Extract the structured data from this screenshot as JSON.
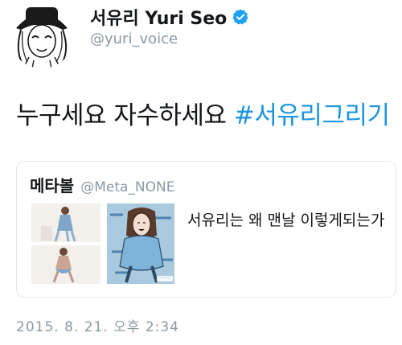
{
  "author": {
    "display_name": "서유리 Yuri Seo",
    "handle": "@yuri_voice",
    "verified": true,
    "avatar_icon": "caricature-avatar-icon"
  },
  "tweet": {
    "text": "누구세요 자수하세요 ",
    "hashtag": "#서유리그리기",
    "timestamp": "2015. 8. 21. 오후 2:34"
  },
  "quoted_tweet": {
    "display_name": "메타볼",
    "handle": "@Meta_NONE",
    "text": "서유리는 왜 맨날 이렇게되는가"
  },
  "colors": {
    "link": "#1b95e0",
    "secondary_text": "#8899a6",
    "border": "#e1e8ed",
    "verified": "#1da1f2"
  }
}
